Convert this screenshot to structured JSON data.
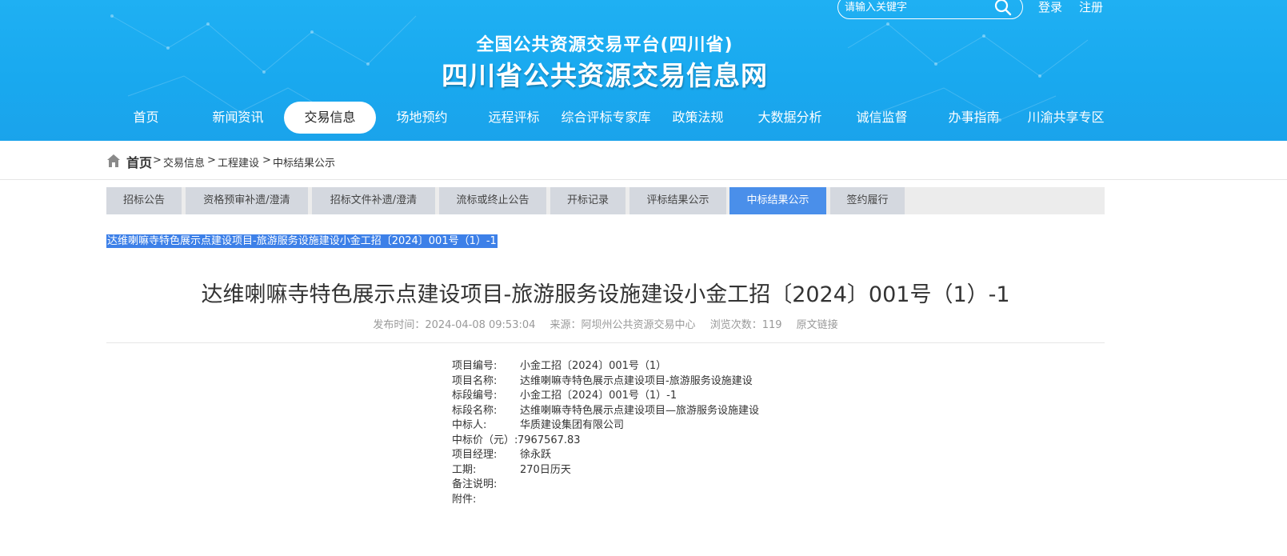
{
  "header": {
    "subtitle": "全国公共资源交易平台(四川省)",
    "title": "四川省公共资源交易信息网",
    "search_placeholder": "请输入关键字",
    "login": "登录",
    "register": "注册"
  },
  "nav": [
    "首页",
    "新闻资讯",
    "交易信息",
    "场地预约",
    "远程评标",
    "综合评标专家库",
    "政策法规",
    "大数据分析",
    "诚信监督",
    "办事指南",
    "川渝共享专区"
  ],
  "breadcrumb": {
    "home": "首页",
    "items": [
      "交易信息",
      "工程建设",
      "中标结果公示"
    ],
    "sep": ">"
  },
  "tabs": [
    "招标公告",
    "资格预审补遗/澄清",
    "招标文件补遗/澄清",
    "流标或终止公告",
    "开标记录",
    "评标结果公示",
    "中标结果公示",
    "签约履行"
  ],
  "selected_text": "达维喇嘛寺特色展示点建设项目-旅游服务设施建设小金工招〔2024〕001号（1）-1",
  "doc": {
    "title": "达维喇嘛寺特色展示点建设项目-旅游服务设施建设小金工招〔2024〕001号（1）-1",
    "publish_time": "发布时间：2024-04-08 09:53:04",
    "source": "来源：阿坝州公共资源交易中心",
    "views": "浏览次数：119",
    "original_link": "原文链接"
  },
  "info": [
    {
      "k": "项目编号:",
      "v": "小金工招〔2024〕001号（1）"
    },
    {
      "k": "项目名称:",
      "v": "达维喇嘛寺特色展示点建设项目-旅游服务设施建设"
    },
    {
      "k": "标段编号:",
      "v": "小金工招〔2024〕001号（1）-1"
    },
    {
      "k": "标段名称:",
      "v": "达维喇嘛寺特色展示点建设项目—旅游服务设施建设"
    },
    {
      "k": "中标人:",
      "v": "华质建设集团有限公司"
    },
    {
      "k": "中标价（元）:",
      "v": "7967567.83"
    },
    {
      "k": "项目经理:",
      "v": "徐永跃"
    },
    {
      "k": "工期:",
      "v": "270日历天"
    },
    {
      "k": "备注说明:",
      "v": ""
    },
    {
      "k": "附件:",
      "v": ""
    }
  ],
  "colors": {
    "header_blue": "#1aa9ef",
    "tab_active": "#4a8fea",
    "tab_inactive": "#d4d8df",
    "selection": "#3d80e8"
  }
}
